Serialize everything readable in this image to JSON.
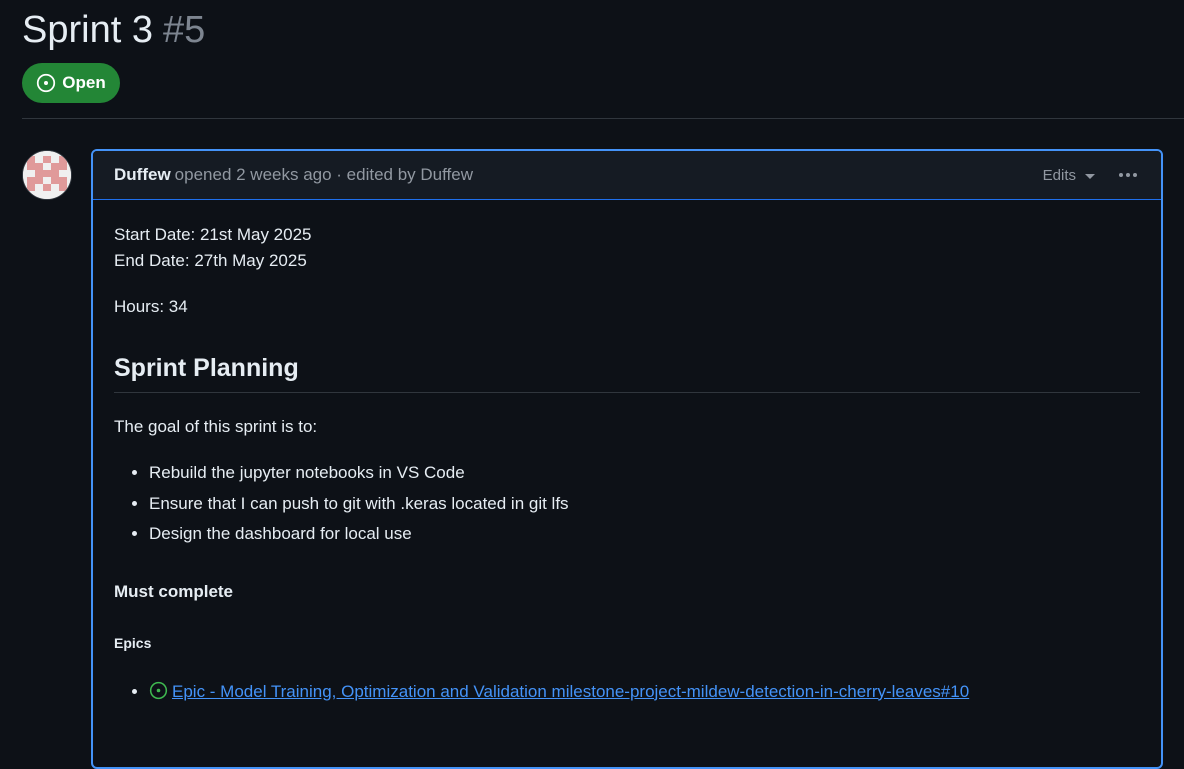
{
  "issue": {
    "title": "Sprint 3",
    "number": "#5",
    "state": "Open",
    "state_color": "#238636"
  },
  "comment": {
    "author": "Duffew",
    "meta": "opened 2 weeks ago · edited by Duffew",
    "edits_label": "Edits",
    "body": {
      "start_date": "Start Date: 21st May 2025",
      "end_date": "End Date: 27th May 2025",
      "hours": "Hours: 34",
      "heading": "Sprint Planning",
      "goal_intro": "The goal of this sprint is to:",
      "goals": [
        "Rebuild the jupyter notebooks in VS Code",
        "Ensure that I can push to git with .keras located in git lfs",
        "Design the dashboard for local use"
      ],
      "must_complete": "Must complete",
      "epics_heading": "Epics",
      "epics": [
        "Epic - Model Training, Optimization and Validation milestone-project-mildew-detection-in-cherry-leaves#10"
      ]
    }
  },
  "colors": {
    "background": "#0d1117",
    "link": "#4493f8",
    "accent_border": "#4493f8",
    "open_green": "#238636",
    "epic_icon_green": "#3fb950"
  },
  "icons": {
    "state": "issue-opened-icon",
    "avatar": "identicon-avatar",
    "menu": "kebab-horizontal-icon"
  }
}
